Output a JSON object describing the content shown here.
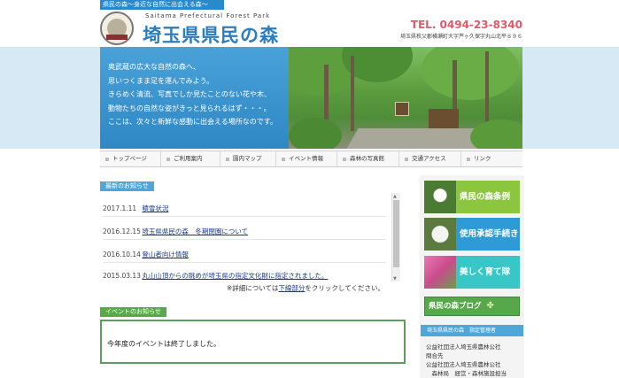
{
  "topbar": {
    "tagline": "県民の森～身近な自然に出会える森～"
  },
  "header": {
    "english_name": "Saitama Prefectural Forest Park",
    "japanese_name": "埼玉県県民の森",
    "tel": "TEL. 0494-23-8340",
    "address": "埼玉県秩父郡横瀬町大字芦ヶ久保字丸山北平８９６"
  },
  "hero": {
    "lines": [
      "奥武蔵の広大な自然の森へ、",
      "思いつくまま足を運んでみよう。",
      "きらめく清流、写真でしか見たことのない花や木、",
      "動物たちの自然な姿がきっと見られるはず・・・。",
      "ここは、次々と新鮮な感動に出会える場所なのです。"
    ]
  },
  "nav": {
    "items": [
      "トップページ",
      "ご利用案内",
      "園内マップ",
      "イベント情報",
      "森林の写真館",
      "交通アクセス",
      "リンク"
    ]
  },
  "news": {
    "heading": "最新のお知らせ",
    "items": [
      {
        "date": "2017.1.11",
        "title": "積雪状況"
      },
      {
        "date": "2016.12.15",
        "title": "埼玉県県民の森　冬期閉園について"
      },
      {
        "date": "2016.10.14",
        "title": "登山者向け情報"
      },
      {
        "date": "2015.03.13",
        "title": "丸山山頂からの眺めが埼玉県の指定文化財に指定されました。"
      }
    ],
    "note_prefix": "※詳細については",
    "note_link": "下線部分",
    "note_suffix": "をクリックしてください。"
  },
  "events": {
    "heading": "イベントのお知らせ",
    "message": "今年度のイベントは終了しました。"
  },
  "sidebar": {
    "banners": [
      {
        "label": "県民の森条例",
        "color": "#8cc63f"
      },
      {
        "label": "使用承認手続き",
        "color": "#2e9ad6"
      },
      {
        "label": "美しく育て隊",
        "color": "#39c6c6"
      }
    ],
    "blog_label": "県民の森ブログ",
    "org_heading": "埼玉県県民の森　指定管理者",
    "org_lines": [
      "公益社団法人埼玉県農林公社",
      "問合先",
      "公益社団法人埼玉県農林公社",
      "　森林局　経営・森林施設担当"
    ]
  }
}
